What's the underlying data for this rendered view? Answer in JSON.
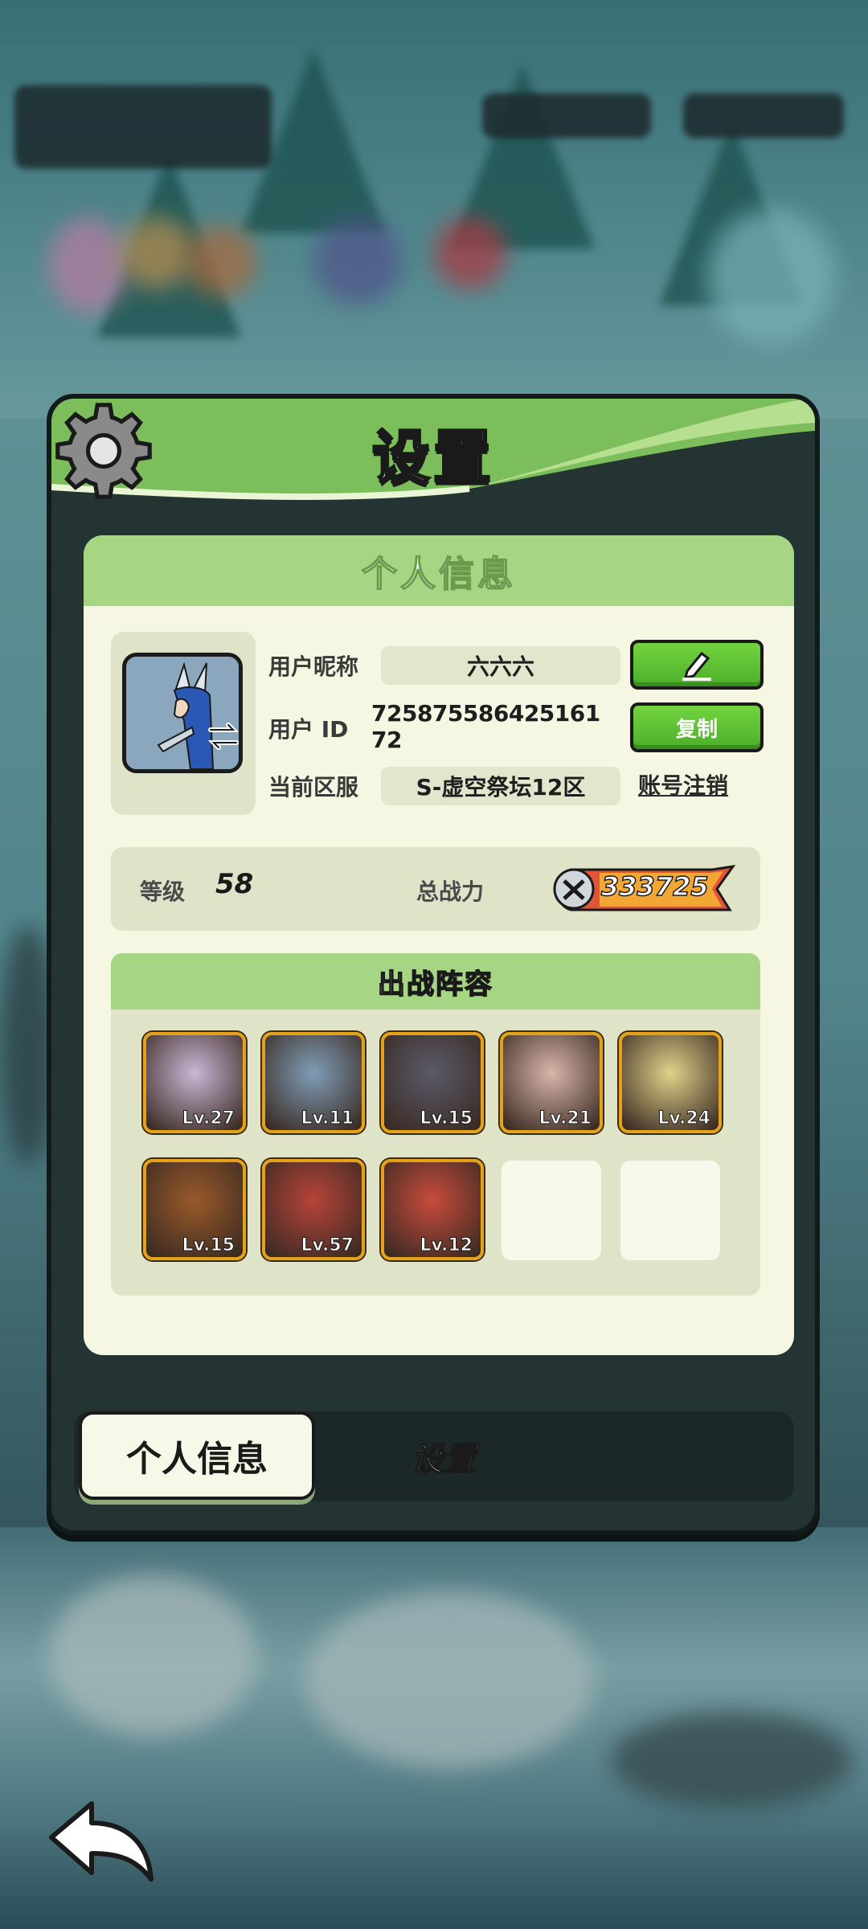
{
  "panel": {
    "title": "设置"
  },
  "profile": {
    "section_title": "个人信息",
    "nickname_label": "用户昵称",
    "nickname": "六六六",
    "id_label": "用户 ID",
    "user_id": "725875586425161 72",
    "server_label": "当前区服",
    "server": "S-虚空祭坛12区",
    "copy_button": "复制",
    "logout_link": "账号注销"
  },
  "stats": {
    "level_label": "等级",
    "level": "58",
    "power_label": "总战力",
    "power": "333725"
  },
  "team": {
    "title": "出战阵容",
    "heroes": [
      {
        "level": "Lv.27",
        "color": "#c9b7d6"
      },
      {
        "level": "Lv.11",
        "color": "#7f9db6"
      },
      {
        "level": "Lv.15",
        "color": "#5a5a6a"
      },
      {
        "level": "Lv.21",
        "color": "#d9b6aa"
      },
      {
        "level": "Lv.24",
        "color": "#e0d28a"
      },
      {
        "level": "Lv.15",
        "color": "#9a5a2a"
      },
      {
        "level": "Lv.57",
        "color": "#b7443a"
      },
      {
        "level": "Lv.12",
        "color": "#c84b3c"
      }
    ]
  },
  "tabs": {
    "profile": "个人信息",
    "settings": "设置"
  },
  "colors": {
    "accent_green": "#73d33f",
    "header_green": "#a6d684",
    "card_bg": "#f5f7e2"
  }
}
